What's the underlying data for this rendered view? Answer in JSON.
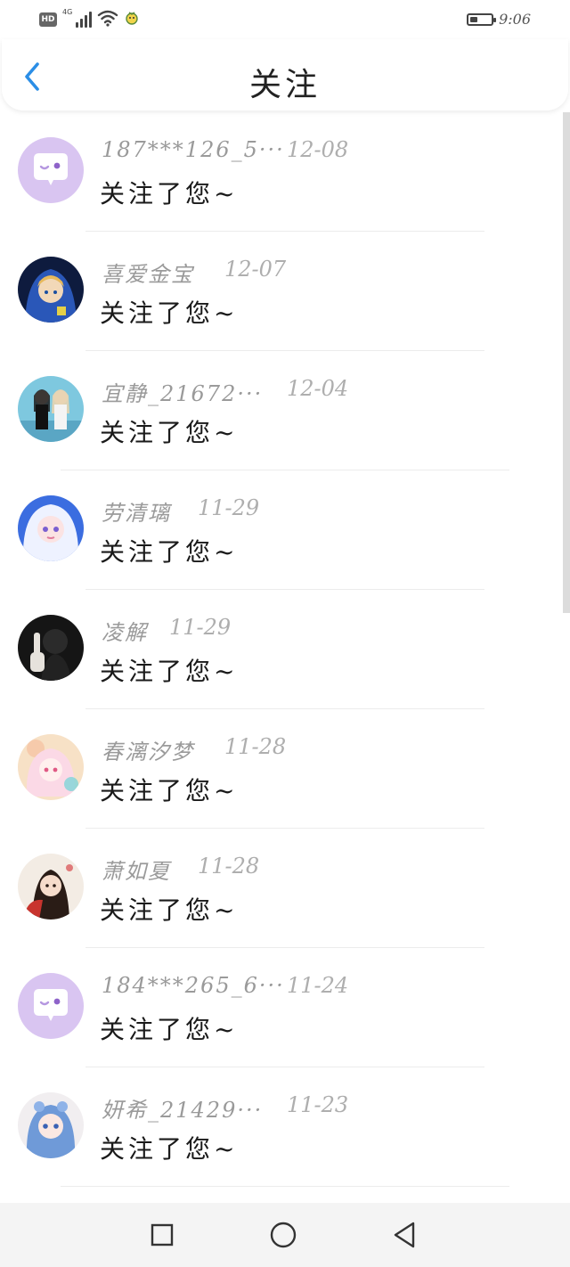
{
  "status_bar": {
    "hd_label": "HD",
    "network_type": "4G",
    "time": "9:06",
    "battery_level": 0.35
  },
  "header": {
    "title": "关注",
    "back_icon": "chevron-left-icon"
  },
  "accent_color": "#2b8ee6",
  "followers": [
    {
      "name": "187***126_5···",
      "date": "12-08",
      "message": "关注了您~",
      "avatar": "default-chat-bubble"
    },
    {
      "name": "喜爱金宝",
      "date": "12-07",
      "message": "关注了您~",
      "avatar": "photo-blue-hood"
    },
    {
      "name": "宜静_21672···",
      "date": "12-04",
      "message": "关注了您~",
      "avatar": "photo-two-girls"
    },
    {
      "name": "劳清璃",
      "date": "11-29",
      "message": "关注了您~",
      "avatar": "photo-white-hair"
    },
    {
      "name": "凌解",
      "date": "11-29",
      "message": "关注了您~",
      "avatar": "photo-dark-hand"
    },
    {
      "name": "春漓汐梦",
      "date": "11-28",
      "message": "关注了您~",
      "avatar": "photo-pink-anime"
    },
    {
      "name": "萧如夏",
      "date": "11-28",
      "message": "关注了您~",
      "avatar": "photo-red-fan"
    },
    {
      "name": "184***265_6···",
      "date": "11-24",
      "message": "关注了您~",
      "avatar": "default-chat-bubble"
    },
    {
      "name": "妍希_21429···",
      "date": "11-23",
      "message": "关注了您~",
      "avatar": "photo-blue-anime"
    }
  ],
  "nav_bar": {
    "buttons": [
      "recent-apps-icon",
      "home-icon",
      "back-triangle-icon"
    ]
  }
}
